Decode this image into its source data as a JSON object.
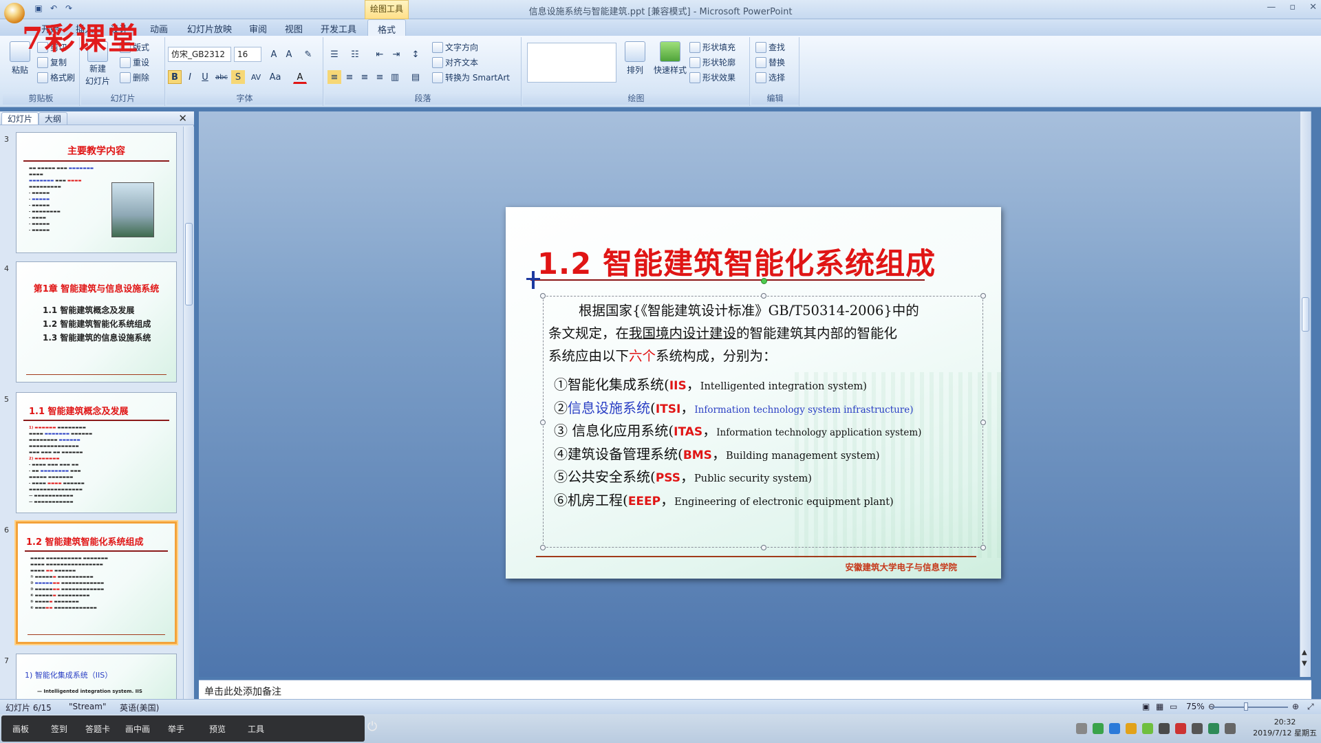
{
  "window": {
    "title": "信息设施系统与智能建筑.ppt [兼容模式] - Microsoft PowerPoint",
    "context_tool": "绘图工具",
    "controls": [
      "—",
      "▫",
      "✕"
    ]
  },
  "watermark": "7彩课堂",
  "tabs": [
    "开始",
    "插入",
    "设计",
    "动画",
    "幻灯片放映",
    "审阅",
    "视图",
    "开发工具",
    "格式"
  ],
  "ribbon": {
    "clipboard": {
      "paste": "粘贴",
      "cut": "剪切",
      "copy": "复制",
      "format_painter": "格式刷",
      "label": "剪贴板"
    },
    "slides": {
      "new_slide": "新建",
      "new_slide2": "幻灯片",
      "layout": "版式",
      "reset": "重设",
      "delete": "删除",
      "label": "幻灯片"
    },
    "font": {
      "family": "仿宋_GB2312",
      "size": "16",
      "label": "字体"
    },
    "paragraph": {
      "text_direction": "文字方向",
      "align_text": "对齐文本",
      "smartart": "转换为 SmartArt",
      "label": "段落"
    },
    "drawing": {
      "arrange": "排列",
      "quick_styles": "快速样式",
      "fill": "形状填充",
      "outline": "形状轮廓",
      "effects": "形状效果",
      "label": "绘图"
    },
    "editing": {
      "find": "查找",
      "replace": "替换",
      "select": "选择",
      "label": "编辑"
    }
  },
  "left_panel": {
    "tab_slides": "幻灯片",
    "tab_outline": "大纲",
    "thumbs": [
      {
        "num": "3",
        "title": "主要教学内容"
      },
      {
        "num": "4",
        "title": "第1章  智能建筑与信息设施系统",
        "items": [
          "1.1 智能建筑概念及发展",
          "1.2 智能建筑智能化系统组成",
          "1.3 智能建筑的信息设施系统"
        ]
      },
      {
        "num": "5",
        "title": "1.1 智能建筑概念及发展"
      },
      {
        "num": "6",
        "title": "1.2 智能建筑智能化系统组成"
      },
      {
        "num": "7",
        "title": "1) 智能化集成系统（IIS）",
        "sub": "— Intelligented integration system. IIS"
      }
    ]
  },
  "slide": {
    "title": "1.2 智能建筑智能化系统组成",
    "para_1": "根据国家{《智能建筑设计标准》GB/T50314-2006}中的",
    "para_2a": "条文规定，在",
    "para_2u": "我国境内设计建设",
    "para_2b": "的智能建筑其内部的智能化",
    "para_3a": "系统应由以下",
    "para_3r": "六个",
    "para_3b": "系统构成，分别为：",
    "items": [
      {
        "n": "①",
        "zh": "智能化集成系统",
        "ab": "IIS",
        "en": "Intelligented integration system)"
      },
      {
        "n": "②",
        "zh": "信息设施系统",
        "ab": "ITSI",
        "en": "Information technology system infrastructure)"
      },
      {
        "n": "③ ",
        "zh": "信息化应用系统",
        "ab": "ITAS",
        "en": "Information technology application system)"
      },
      {
        "n": "④",
        "zh": "建筑设备管理系统",
        "ab": "BMS",
        "en": "Building management system)"
      },
      {
        "n": "⑤",
        "zh": "公共安全系统",
        "ab": "PSS",
        "en": "Public security system)"
      },
      {
        "n": "⑥",
        "zh": "机房工程",
        "ab": "EEEP",
        "en": "Engineering of electronic equipment plant)"
      }
    ],
    "footer": "安徽建筑大学电子与信息学院"
  },
  "notes_placeholder": "单击此处添加备注",
  "status": {
    "slide_count": "幻灯片 6/15",
    "theme": "\"Stream\"",
    "language": "英语(美国)",
    "zoom": "75%",
    "zoom_level": 0.75
  },
  "taskbar": {
    "items": [
      "画板",
      "签到",
      "答题卡",
      "画中画",
      "举手",
      "预览",
      "工具"
    ],
    "time": "20:32",
    "date": "2019/7/12 星期五"
  },
  "colors": {
    "accent_red": "#e01515",
    "blue_text": "#2a3fc4",
    "ribbon_blue": "#dbe8f7"
  }
}
